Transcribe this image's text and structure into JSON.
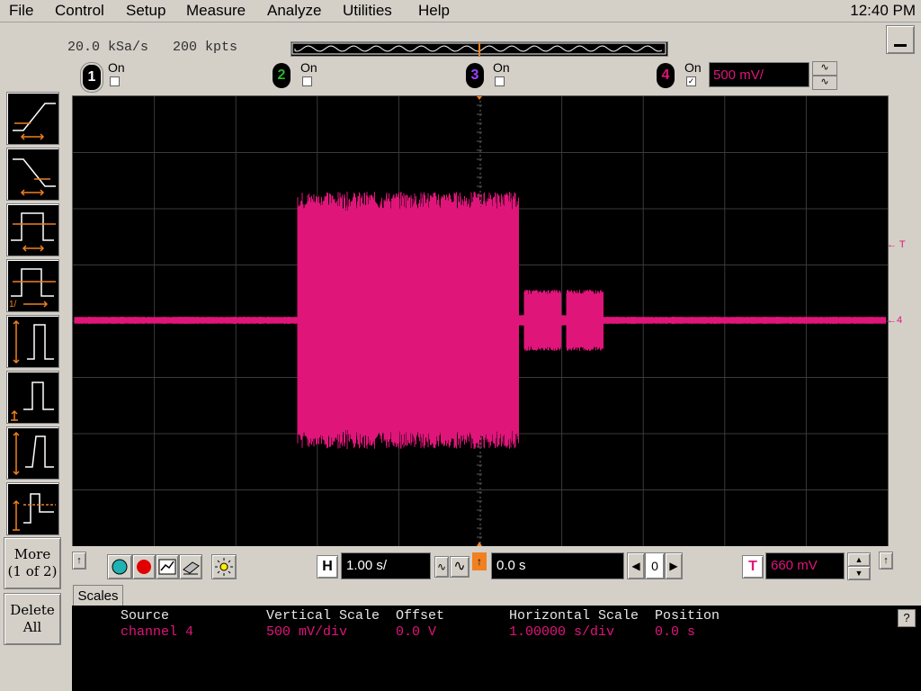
{
  "menu": {
    "items": [
      "File",
      "Control",
      "Setup",
      "Measure",
      "Analyze",
      "Utilities",
      "Help"
    ],
    "clock": "12:40 PM"
  },
  "acquisition": {
    "sample_rate": "20.0 kSa/s",
    "memory": "200 kpts"
  },
  "channels": [
    {
      "number": "1",
      "label": "On",
      "checked": false,
      "color": "#2db32d"
    },
    {
      "number": "2",
      "label": "On",
      "checked": false,
      "color": "#2db32d"
    },
    {
      "number": "3",
      "label": "On",
      "checked": false,
      "color": "#8a2be2"
    },
    {
      "number": "4",
      "label": "On",
      "checked": true,
      "color": "#e0157a"
    }
  ],
  "channel4": {
    "vertical_scale": "500 mV/"
  },
  "waveform": {
    "color": "#e0157a",
    "markers": {
      "trigger_level": "T",
      "channel_ground": "4"
    }
  },
  "left_panel": {
    "more_label": "More",
    "more_page": "(1 of 2)",
    "delete_label": "Delete",
    "delete_all": "All"
  },
  "horizontal": {
    "badge": "H",
    "scale": "1.00 s/",
    "delay": "0.0 s",
    "step_value": "0"
  },
  "trigger": {
    "badge": "T",
    "level": "660 mV"
  },
  "measurements": {
    "tab": "Scales",
    "headers": [
      "Source",
      "Vertical Scale",
      "Offset",
      "Horizontal Scale",
      "Position"
    ],
    "values": [
      "channel 4",
      "500 mV/div",
      "0.0 V",
      "1.00000 s/div",
      "0.0 s"
    ],
    "help": "?"
  },
  "colors": {
    "accent": "#e0157a",
    "orange": "#f08020",
    "panel": "#d4d0c8"
  }
}
